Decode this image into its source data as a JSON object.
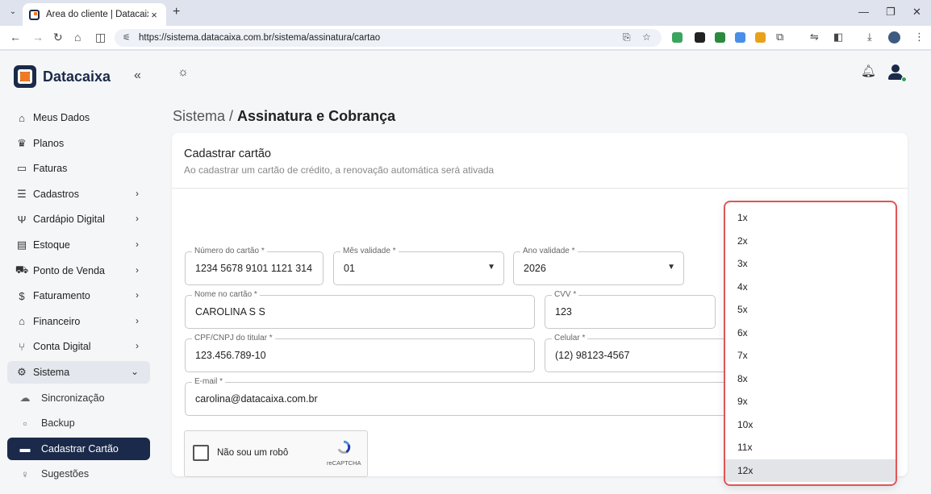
{
  "browser": {
    "tab_title": "Área do cliente | Datacaixa",
    "tab_close": "×",
    "new_tab": "+",
    "url": "https://sistema.datacaixa.com.br/sistema/assinatura/cartao"
  },
  "app": {
    "brand": "Datacaixa",
    "collapse_icon": "«"
  },
  "sidebar": {
    "items": [
      {
        "label": "Meus Dados",
        "icon": "id-card-icon",
        "glyph": "⌂",
        "chevron": ""
      },
      {
        "label": "Planos",
        "icon": "crown-icon",
        "glyph": "♛",
        "chevron": ""
      },
      {
        "label": "Faturas",
        "icon": "laptop-icon",
        "glyph": "▭",
        "chevron": ""
      },
      {
        "label": "Cadastros",
        "icon": "list-icon",
        "glyph": "☰",
        "chevron": "›"
      },
      {
        "label": "Cardápio Digital",
        "icon": "fork-knife-icon",
        "glyph": "Ψ",
        "chevron": "›"
      },
      {
        "label": "Estoque",
        "icon": "archive-icon",
        "glyph": "▤",
        "chevron": "›"
      },
      {
        "label": "Ponto de Venda",
        "icon": "cart-icon",
        "glyph": "⛟",
        "chevron": "›"
      },
      {
        "label": "Faturamento",
        "icon": "dollar-circle-icon",
        "glyph": "$",
        "chevron": "›"
      },
      {
        "label": "Financeiro",
        "icon": "bank-icon",
        "glyph": "⌂",
        "chevron": "›"
      },
      {
        "label": "Conta Digital",
        "icon": "share-icon",
        "glyph": "⑂",
        "chevron": "›"
      },
      {
        "label": "Sistema",
        "icon": "gear-icon",
        "glyph": "⚙",
        "chevron": "⌄"
      },
      {
        "label": "Sincronização",
        "icon": "cloud-icon",
        "glyph": "☁",
        "chevron": ""
      },
      {
        "label": "Backup",
        "icon": "save-icon",
        "glyph": "▫",
        "chevron": ""
      },
      {
        "label": "Cadastrar Cartão",
        "icon": "credit-card-icon",
        "glyph": "▬",
        "chevron": ""
      },
      {
        "label": "Sugestões",
        "icon": "lightbulb-icon",
        "glyph": "♀",
        "chevron": ""
      }
    ]
  },
  "breadcrumb": {
    "section": "Sistema / ",
    "page": "Assinatura e Cobrança"
  },
  "card": {
    "title": "Cadastrar cartão",
    "subtitle": "Ao cadastrar um cartão de crédito, a renovação automática será ativada"
  },
  "form": {
    "card_number": {
      "label": "Número do cartão *",
      "value": "1234 5678 9101 1121 314"
    },
    "month": {
      "label": "Mês validade *",
      "value": "01"
    },
    "year": {
      "label": "Ano validade *",
      "value": "2026"
    },
    "name": {
      "label": "Nome no cartão *",
      "value": "CAROLINA S S"
    },
    "cvv": {
      "label": "CVV *",
      "value": "123"
    },
    "cpf": {
      "label": "CPF/CNPJ do titular *",
      "value": "123.456.789-10"
    },
    "phone": {
      "label": "Celular *",
      "value": "(12) 98123-4567"
    },
    "email": {
      "label": "E-mail *",
      "value": "carolina@datacaixa.com.br"
    }
  },
  "captcha": {
    "label": "Não sou um robô",
    "brand": "reCAPTCHA"
  },
  "installments": {
    "options": [
      "1x",
      "2x",
      "3x",
      "4x",
      "5x",
      "6x",
      "7x",
      "8x",
      "9x",
      "10x",
      "11x",
      "12x"
    ],
    "selected": "12x"
  },
  "colors": {
    "primary": "#1b2a4a",
    "accent": "#f07a22",
    "highlight_border": "#e05555"
  }
}
